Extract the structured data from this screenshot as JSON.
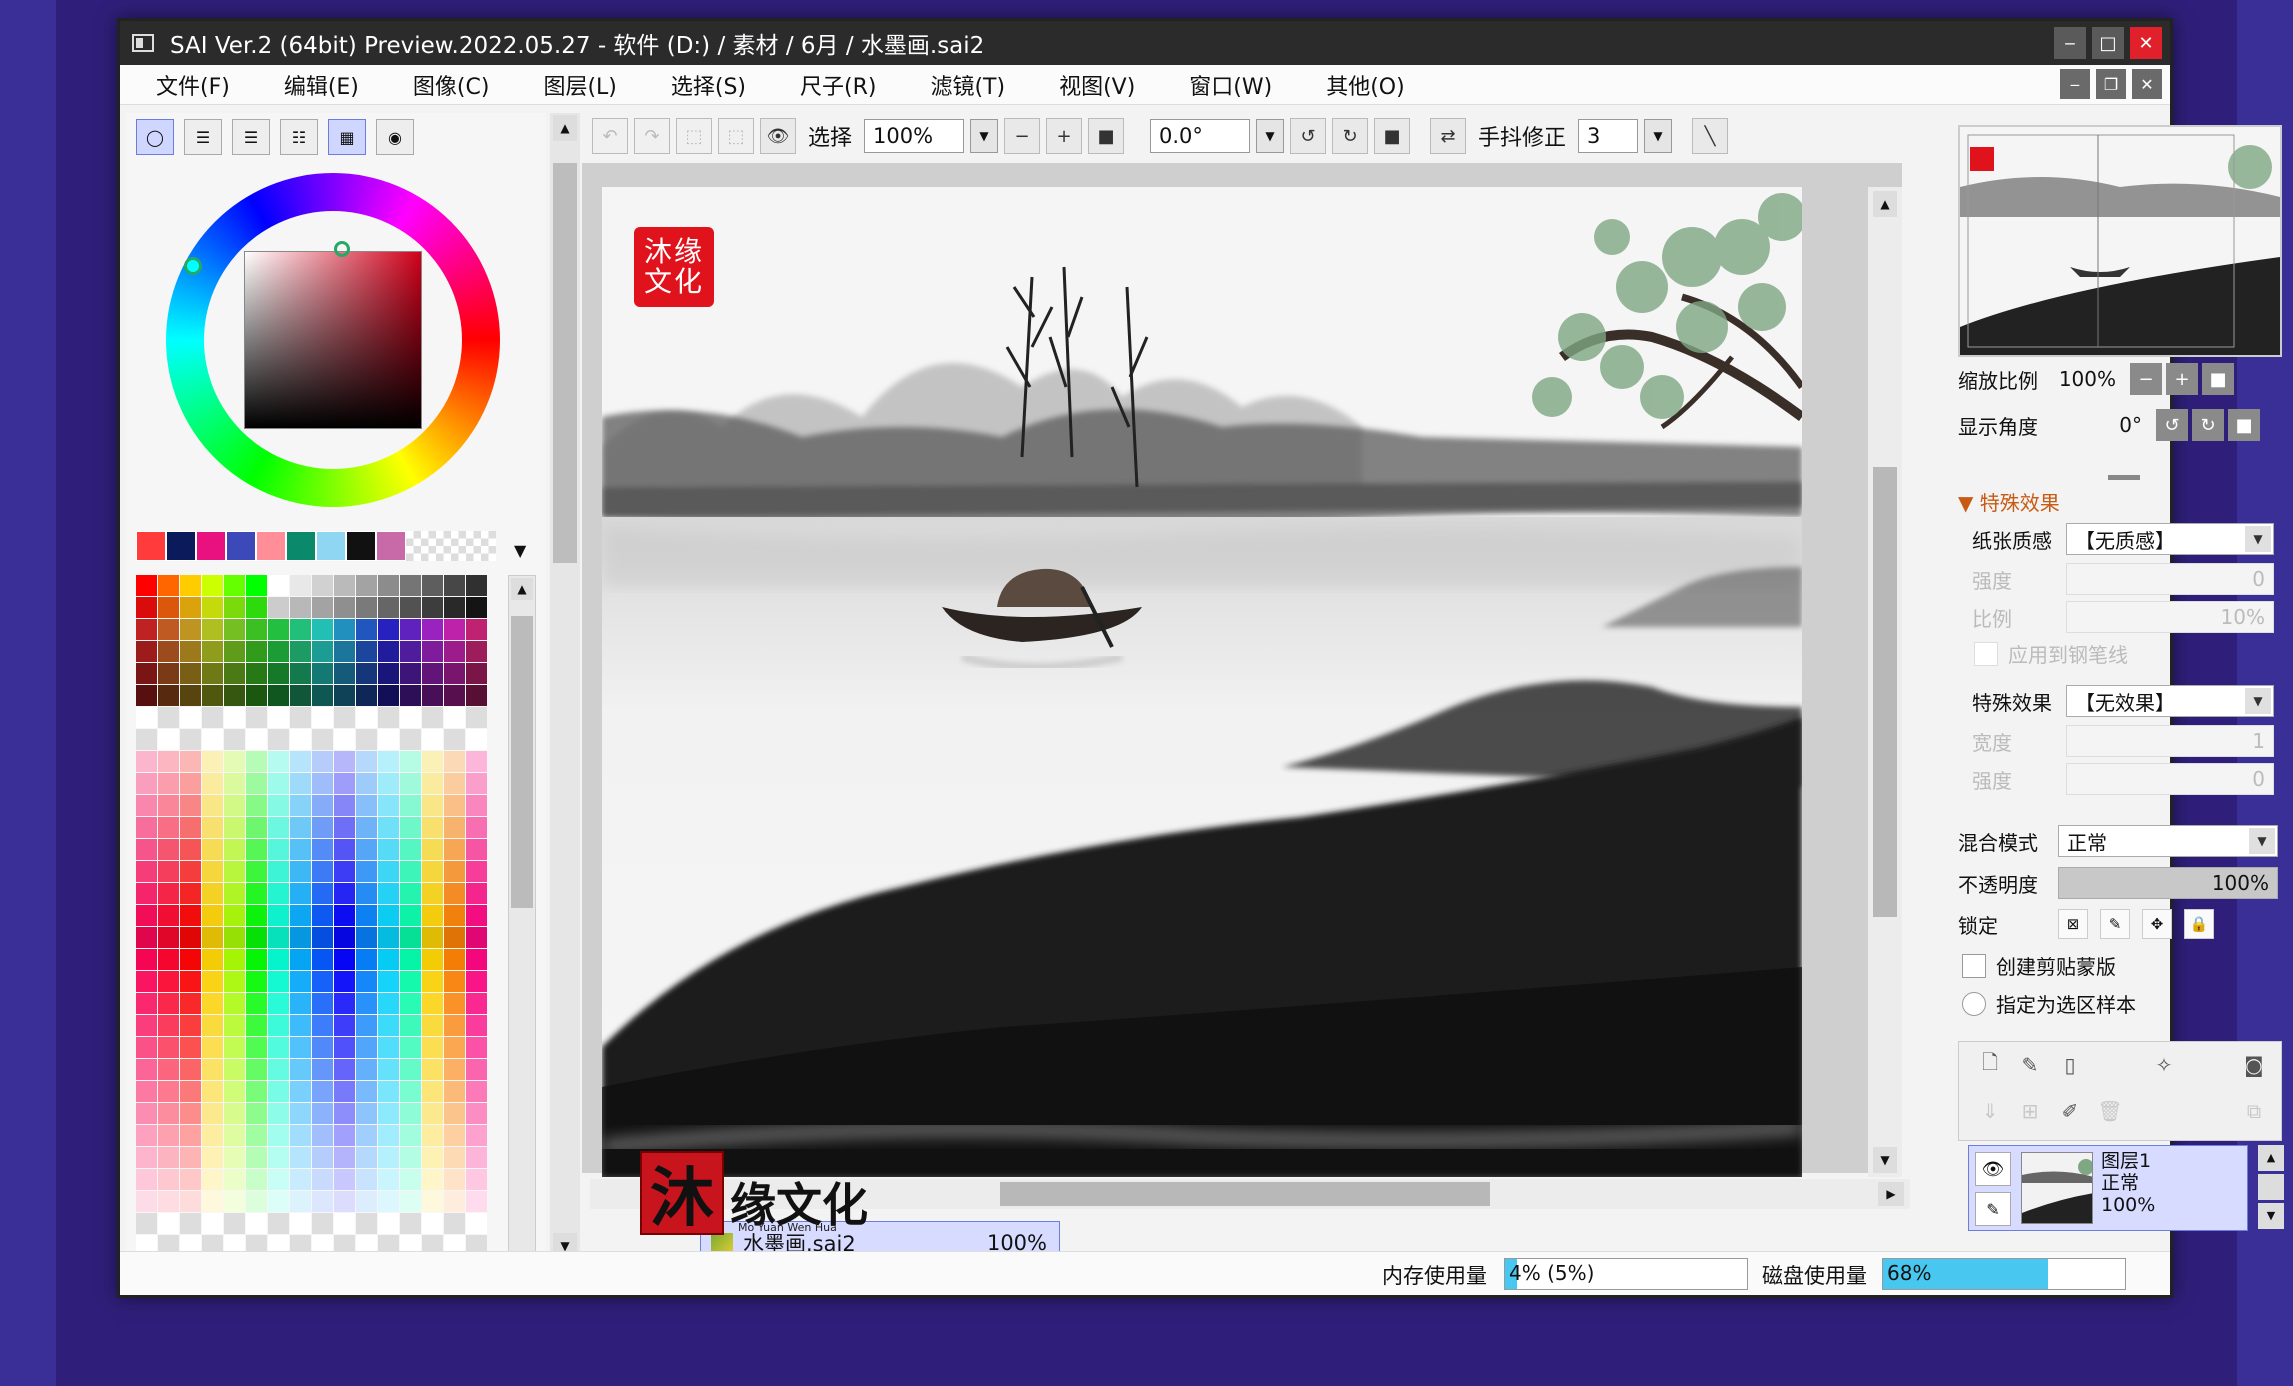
{
  "window": {
    "title": "SAI Ver.2 (64bit) Preview.2022.05.27 - 软件 (D:) / 素材 / 6月 / 水墨画.sai2",
    "min": "‒",
    "max": "□",
    "close": "✕"
  },
  "menu": [
    "文件(F)",
    "编辑(E)",
    "图像(C)",
    "图层(L)",
    "选择(S)",
    "尺子(R)",
    "滤镜(T)",
    "视图(V)",
    "窗口(W)",
    "其他(O)"
  ],
  "mdi": {
    "min": "‒",
    "restore": "❐",
    "close": "✕"
  },
  "toolbar": {
    "select_label": "选择",
    "zoom_value": "100%",
    "angle_value": "0.0°",
    "stabilizer_label": "手抖修正",
    "stabilizer_value": "3"
  },
  "swatches": [
    "#ff3b3b",
    "#0a1a5a",
    "#e8117f",
    "#3c49b8",
    "#ff8e99",
    "#0a8a6a",
    "#8fd6f2",
    "#111111",
    "#c96aa8"
  ],
  "canvas": {
    "seal_chars": "沐缘文化",
    "watermark": {
      "seal": "沐",
      "text": "缘文化",
      "sub": "Mo Yuan Wen Hua"
    }
  },
  "document_tab": {
    "name": "水墨画.sai2",
    "zoom": "100%"
  },
  "navigator": {
    "zoom_label": "缩放比例",
    "zoom_value": "100%",
    "angle_label": "显示角度",
    "angle_value": "0°"
  },
  "effects": {
    "title": "特殊效果",
    "paper_label": "纸张质感",
    "paper_value": "【无质感】",
    "strength_label": "强度",
    "strength_value": "0",
    "scale_label": "比例",
    "scale_value": "10%",
    "apply_pen_label": "应用到钢笔线",
    "effect_label": "特殊效果",
    "effect_value": "【无效果】",
    "width_label": "宽度",
    "width_value": "1",
    "strength2_label": "强度",
    "strength2_value": "0"
  },
  "layer_props": {
    "blend_label": "混合模式",
    "blend_value": "正常",
    "opacity_label": "不透明度",
    "opacity_value": "100%",
    "lock_label": "锁定",
    "clip_label": "创建剪贴蒙版",
    "sample_label": "指定为选区样本"
  },
  "layer": {
    "name": "图层1",
    "mode": "正常",
    "opacity": "100%"
  },
  "status": {
    "mem_label": "内存使用量",
    "mem_value": "4% (5%)",
    "mem_fraction": 0.05,
    "disk_label": "磁盘使用量",
    "disk_value": "68%",
    "disk_fraction": 0.68
  }
}
